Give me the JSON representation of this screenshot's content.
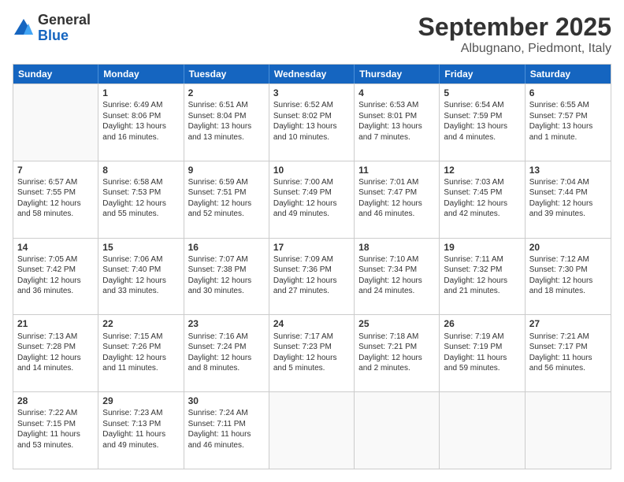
{
  "logo": {
    "general": "General",
    "blue": "Blue"
  },
  "header": {
    "month": "September 2025",
    "location": "Albugnano, Piedmont, Italy"
  },
  "days": [
    "Sunday",
    "Monday",
    "Tuesday",
    "Wednesday",
    "Thursday",
    "Friday",
    "Saturday"
  ],
  "weeks": [
    [
      {
        "num": "",
        "content": ""
      },
      {
        "num": "1",
        "content": "Sunrise: 6:49 AM\nSunset: 8:06 PM\nDaylight: 13 hours\nand 16 minutes."
      },
      {
        "num": "2",
        "content": "Sunrise: 6:51 AM\nSunset: 8:04 PM\nDaylight: 13 hours\nand 13 minutes."
      },
      {
        "num": "3",
        "content": "Sunrise: 6:52 AM\nSunset: 8:02 PM\nDaylight: 13 hours\nand 10 minutes."
      },
      {
        "num": "4",
        "content": "Sunrise: 6:53 AM\nSunset: 8:01 PM\nDaylight: 13 hours\nand 7 minutes."
      },
      {
        "num": "5",
        "content": "Sunrise: 6:54 AM\nSunset: 7:59 PM\nDaylight: 13 hours\nand 4 minutes."
      },
      {
        "num": "6",
        "content": "Sunrise: 6:55 AM\nSunset: 7:57 PM\nDaylight: 13 hours\nand 1 minute."
      }
    ],
    [
      {
        "num": "7",
        "content": "Sunrise: 6:57 AM\nSunset: 7:55 PM\nDaylight: 12 hours\nand 58 minutes."
      },
      {
        "num": "8",
        "content": "Sunrise: 6:58 AM\nSunset: 7:53 PM\nDaylight: 12 hours\nand 55 minutes."
      },
      {
        "num": "9",
        "content": "Sunrise: 6:59 AM\nSunset: 7:51 PM\nDaylight: 12 hours\nand 52 minutes."
      },
      {
        "num": "10",
        "content": "Sunrise: 7:00 AM\nSunset: 7:49 PM\nDaylight: 12 hours\nand 49 minutes."
      },
      {
        "num": "11",
        "content": "Sunrise: 7:01 AM\nSunset: 7:47 PM\nDaylight: 12 hours\nand 46 minutes."
      },
      {
        "num": "12",
        "content": "Sunrise: 7:03 AM\nSunset: 7:45 PM\nDaylight: 12 hours\nand 42 minutes."
      },
      {
        "num": "13",
        "content": "Sunrise: 7:04 AM\nSunset: 7:44 PM\nDaylight: 12 hours\nand 39 minutes."
      }
    ],
    [
      {
        "num": "14",
        "content": "Sunrise: 7:05 AM\nSunset: 7:42 PM\nDaylight: 12 hours\nand 36 minutes."
      },
      {
        "num": "15",
        "content": "Sunrise: 7:06 AM\nSunset: 7:40 PM\nDaylight: 12 hours\nand 33 minutes."
      },
      {
        "num": "16",
        "content": "Sunrise: 7:07 AM\nSunset: 7:38 PM\nDaylight: 12 hours\nand 30 minutes."
      },
      {
        "num": "17",
        "content": "Sunrise: 7:09 AM\nSunset: 7:36 PM\nDaylight: 12 hours\nand 27 minutes."
      },
      {
        "num": "18",
        "content": "Sunrise: 7:10 AM\nSunset: 7:34 PM\nDaylight: 12 hours\nand 24 minutes."
      },
      {
        "num": "19",
        "content": "Sunrise: 7:11 AM\nSunset: 7:32 PM\nDaylight: 12 hours\nand 21 minutes."
      },
      {
        "num": "20",
        "content": "Sunrise: 7:12 AM\nSunset: 7:30 PM\nDaylight: 12 hours\nand 18 minutes."
      }
    ],
    [
      {
        "num": "21",
        "content": "Sunrise: 7:13 AM\nSunset: 7:28 PM\nDaylight: 12 hours\nand 14 minutes."
      },
      {
        "num": "22",
        "content": "Sunrise: 7:15 AM\nSunset: 7:26 PM\nDaylight: 12 hours\nand 11 minutes."
      },
      {
        "num": "23",
        "content": "Sunrise: 7:16 AM\nSunset: 7:24 PM\nDaylight: 12 hours\nand 8 minutes."
      },
      {
        "num": "24",
        "content": "Sunrise: 7:17 AM\nSunset: 7:23 PM\nDaylight: 12 hours\nand 5 minutes."
      },
      {
        "num": "25",
        "content": "Sunrise: 7:18 AM\nSunset: 7:21 PM\nDaylight: 12 hours\nand 2 minutes."
      },
      {
        "num": "26",
        "content": "Sunrise: 7:19 AM\nSunset: 7:19 PM\nDaylight: 11 hours\nand 59 minutes."
      },
      {
        "num": "27",
        "content": "Sunrise: 7:21 AM\nSunset: 7:17 PM\nDaylight: 11 hours\nand 56 minutes."
      }
    ],
    [
      {
        "num": "28",
        "content": "Sunrise: 7:22 AM\nSunset: 7:15 PM\nDaylight: 11 hours\nand 53 minutes."
      },
      {
        "num": "29",
        "content": "Sunrise: 7:23 AM\nSunset: 7:13 PM\nDaylight: 11 hours\nand 49 minutes."
      },
      {
        "num": "30",
        "content": "Sunrise: 7:24 AM\nSunset: 7:11 PM\nDaylight: 11 hours\nand 46 minutes."
      },
      {
        "num": "",
        "content": ""
      },
      {
        "num": "",
        "content": ""
      },
      {
        "num": "",
        "content": ""
      },
      {
        "num": "",
        "content": ""
      }
    ]
  ]
}
